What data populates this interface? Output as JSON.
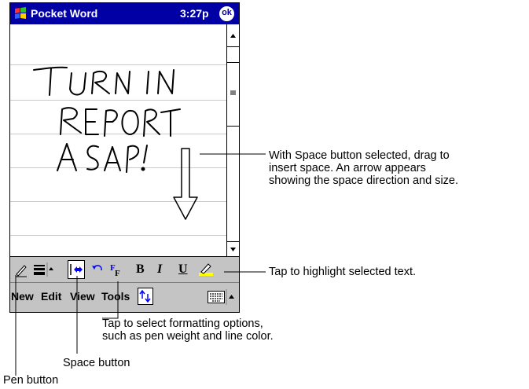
{
  "window": {
    "title": "Pocket Word",
    "time": "3:27p",
    "ok_label": "ok"
  },
  "document": {
    "handwriting": [
      "TURN IN",
      "REPORT",
      "A SAP!"
    ]
  },
  "toolbar": {
    "pen_icon": "pen-icon",
    "bold_label": "B",
    "italic_label": "I",
    "underline_label": "U",
    "format_label": "F"
  },
  "menubar": {
    "items": [
      "New",
      "Edit",
      "View",
      "Tools"
    ]
  },
  "callouts": {
    "space_drag": [
      "With Space button selected, drag to",
      "insert space. An arrow appears",
      "showing the space direction and size."
    ],
    "highlight": "Tap to highlight selected text.",
    "formatting": [
      "Tap to select formatting options,",
      "such as pen weight and line color."
    ],
    "space_button": "Space button",
    "pen_button": "Pen button"
  },
  "colors": {
    "titlebar": "#0000a5",
    "toolbar": "#c4c4c4",
    "highlight_yellow": "#ffff00"
  }
}
